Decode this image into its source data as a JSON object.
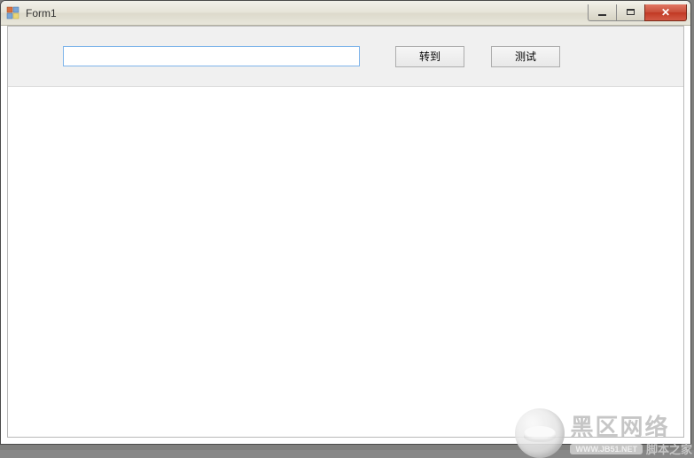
{
  "window": {
    "title": "Form1"
  },
  "toolbar": {
    "address_value": "",
    "go_label": "转到",
    "test_label": "测试"
  },
  "watermark": {
    "main": "黑区网络",
    "sub": "脚本之家",
    "url": "WWW.JB51.NET"
  }
}
